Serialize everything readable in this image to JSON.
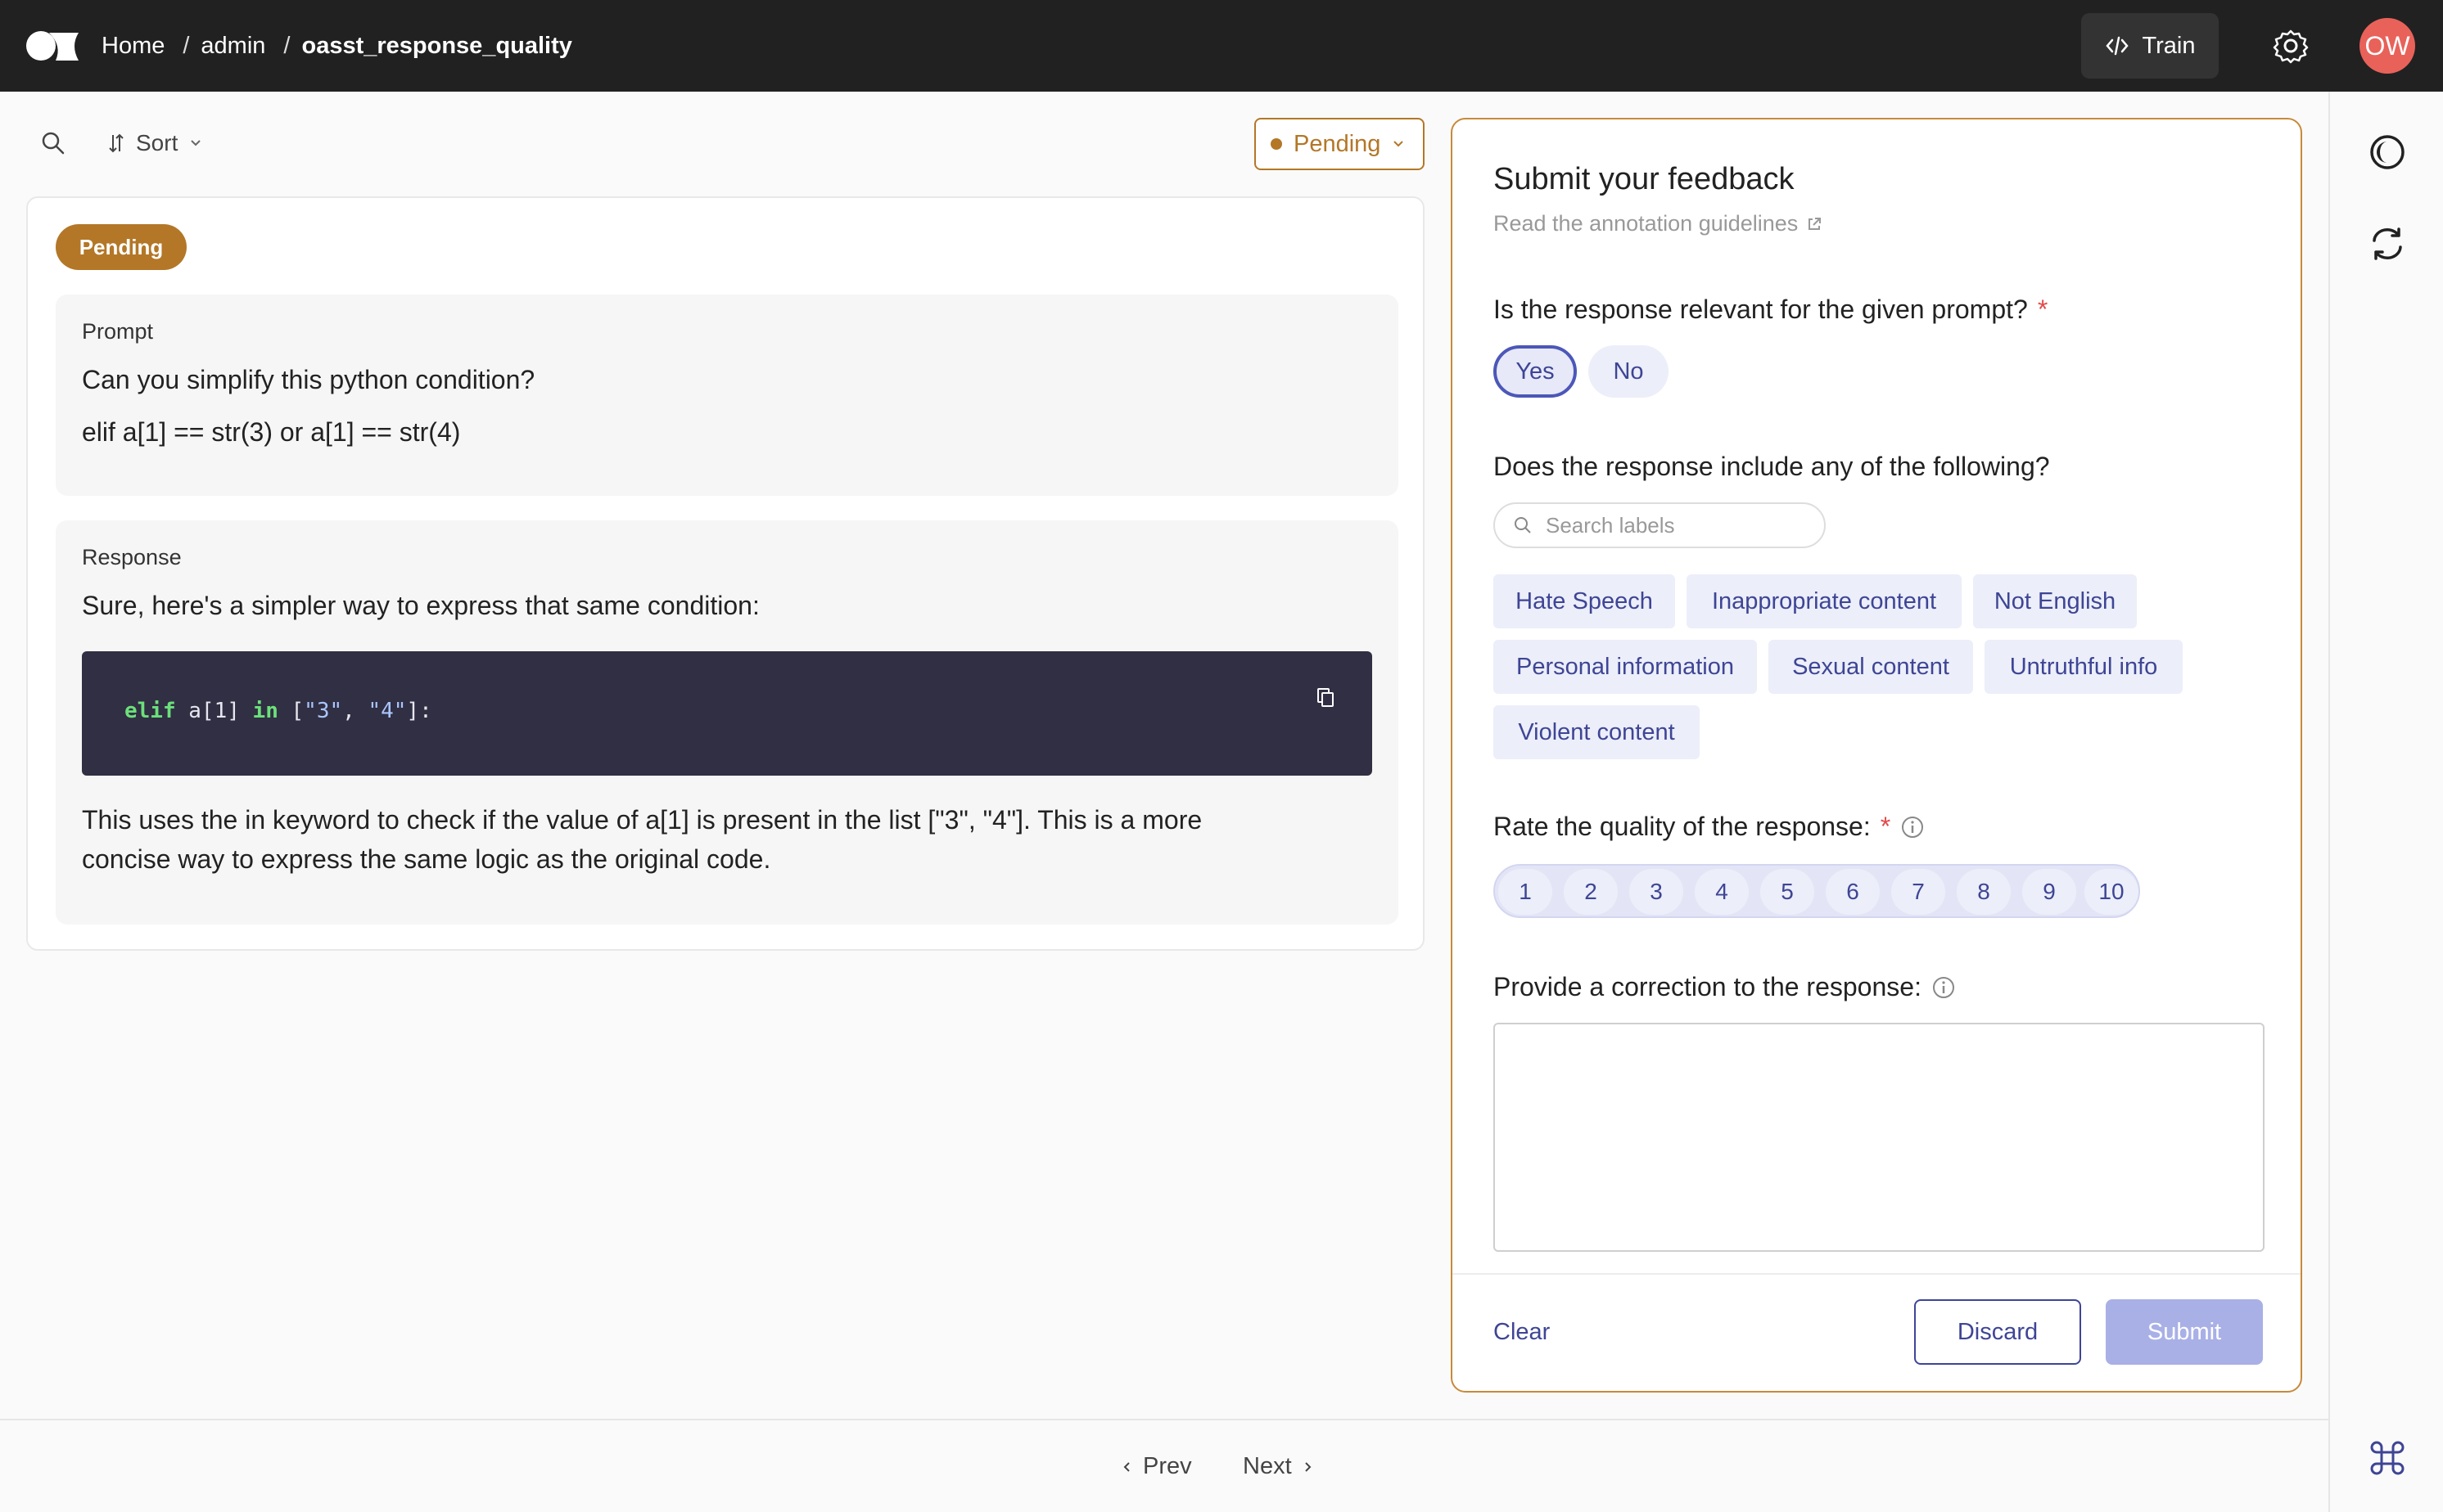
{
  "header": {
    "breadcrumb": [
      "Home",
      "admin",
      "oasst_response_quality"
    ],
    "train_label": "Train",
    "avatar_initials": "OW"
  },
  "toolbar": {
    "sort_label": "Sort",
    "status_value": "Pending"
  },
  "record": {
    "status_badge": "Pending",
    "fields": {
      "prompt": {
        "title": "Prompt",
        "lines": [
          "Can you simplify this python condition?",
          "elif a[1] == str(3) or a[1] == str(4)"
        ]
      },
      "response": {
        "title": "Response",
        "intro": "Sure, here's a simpler way to express that same condition:",
        "code": {
          "kw1": "elif",
          "mid1": " a[1] ",
          "kw2": "in",
          "mid2": " [",
          "str1": "\"3\"",
          "comma": ", ",
          "str2": "\"4\"",
          "end": "]:"
        },
        "outro_line1": "This uses the in keyword to check if the value of a[1] is present in the list [\"3\", \"4\"]. This is a more",
        "outro_line2": "concise way to express the same logic as the original code."
      }
    }
  },
  "feedback": {
    "title": "Submit your feedback",
    "guidelines_link": "Read the annotation guidelines",
    "questions": {
      "relevant": {
        "label": "Is the response relevant for the given prompt?",
        "required_mark": "*",
        "options": [
          "Yes",
          "No"
        ],
        "selected": "Yes"
      },
      "content_class": {
        "label": "Does the response include any of the following?",
        "search_placeholder": "Search labels",
        "labels": [
          "Hate Speech",
          "Inappropriate content",
          "Not English",
          "Personal information",
          "Sexual content",
          "Untruthful info",
          "Violent content"
        ]
      },
      "rating": {
        "label": "Rate the quality of the response:",
        "required_mark": "*",
        "values": [
          "1",
          "2",
          "3",
          "4",
          "5",
          "6",
          "7",
          "8",
          "9",
          "10"
        ]
      },
      "correction": {
        "label": "Provide a correction to the response:",
        "value": ""
      }
    },
    "actions": {
      "clear": "Clear",
      "discard": "Discard",
      "submit": "Submit"
    }
  },
  "pagination": {
    "prev": "Prev",
    "next": "Next"
  },
  "colors": {
    "topbar": "#212121",
    "pending": "#b37727",
    "accent": "#3e4595",
    "avatar": "#e8625a",
    "required": "#e14a4a",
    "code_bg": "#312f43"
  }
}
